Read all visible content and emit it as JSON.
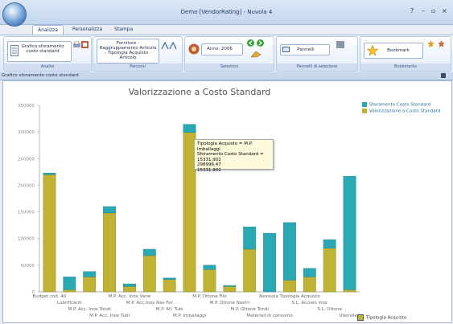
{
  "window": {
    "title": "Demo [VendorRating] - Nuvola 4",
    "controls": [
      "?",
      "–",
      "▫",
      "×"
    ]
  },
  "tabs": [
    "Analizza",
    "Personalizza",
    "Stampa"
  ],
  "ribbon": {
    "analisi": {
      "button": "Grafico sforamento costo standard",
      "label": "Analisi"
    },
    "percorsi": {
      "button": "Fornitore - Raggruppamento Articolo - Tipologia Acquisto - Articolo",
      "label": "Percorsi"
    },
    "selezioni": {
      "anno": "Anno: 2006",
      "label": "Selezioni"
    },
    "pannelli": {
      "button": "Pannelli",
      "label": "Pannelli di selezione"
    },
    "bookmarks": {
      "button": "Bookmark",
      "label": "Bookmarks"
    }
  },
  "panel_title": "Grafico sforamento costo standard",
  "colors": {
    "sforamento": "#2aa9b4",
    "valorizzazione": "#bfb234"
  },
  "tooltip": {
    "line1": "Tipologia Acquisto = M.P. Imballaggi",
    "line2": "Sforamento Costo Standard = 15331,902",
    "line3": "298996,47",
    "line4": "15331,902"
  },
  "footer_legend": "Tipologia Acquisto",
  "chart_data": {
    "type": "bar",
    "title": "Valorizzazione a Costo Standard",
    "ylim": [
      0,
      350000
    ],
    "yticks": [
      0,
      50000,
      100000,
      150000,
      200000,
      250000,
      300000,
      350000
    ],
    "categories": [
      "Budget cod. 40",
      "Lubrificanti",
      "M.P. Acc. Inox Tondi",
      "M.P. Acc. Inox Tubi",
      "M.P. Acc. Inox Vane",
      "M.P. Acc.Inox Nas Fer",
      "M.P. All. Tubi",
      "M.P. Imballaggi",
      "M.P. Ottone Filo",
      "M.P. Ottone Nastri",
      "M.P. Ottone Tondi",
      "Materiali di consumo",
      "Nessuna Tipologia Acquisto",
      "S.L. Acciaio inox",
      "S.L. Ottone",
      "Utensileri"
    ],
    "series": [
      {
        "name": "Valorizzazione a Costo Standard",
        "values": [
          220000,
          4000,
          28000,
          148000,
          10000,
          68000,
          23000,
          298996,
          42000,
          10000,
          80000,
          0,
          22000,
          28000,
          82000,
          4000
        ]
      },
      {
        "name": "Sforamento Costo Standard",
        "values": [
          3000,
          24000,
          10000,
          12000,
          5000,
          12000,
          3000,
          15332,
          8000,
          2000,
          42000,
          110000,
          108000,
          16000,
          16000,
          213000
        ]
      }
    ]
  }
}
